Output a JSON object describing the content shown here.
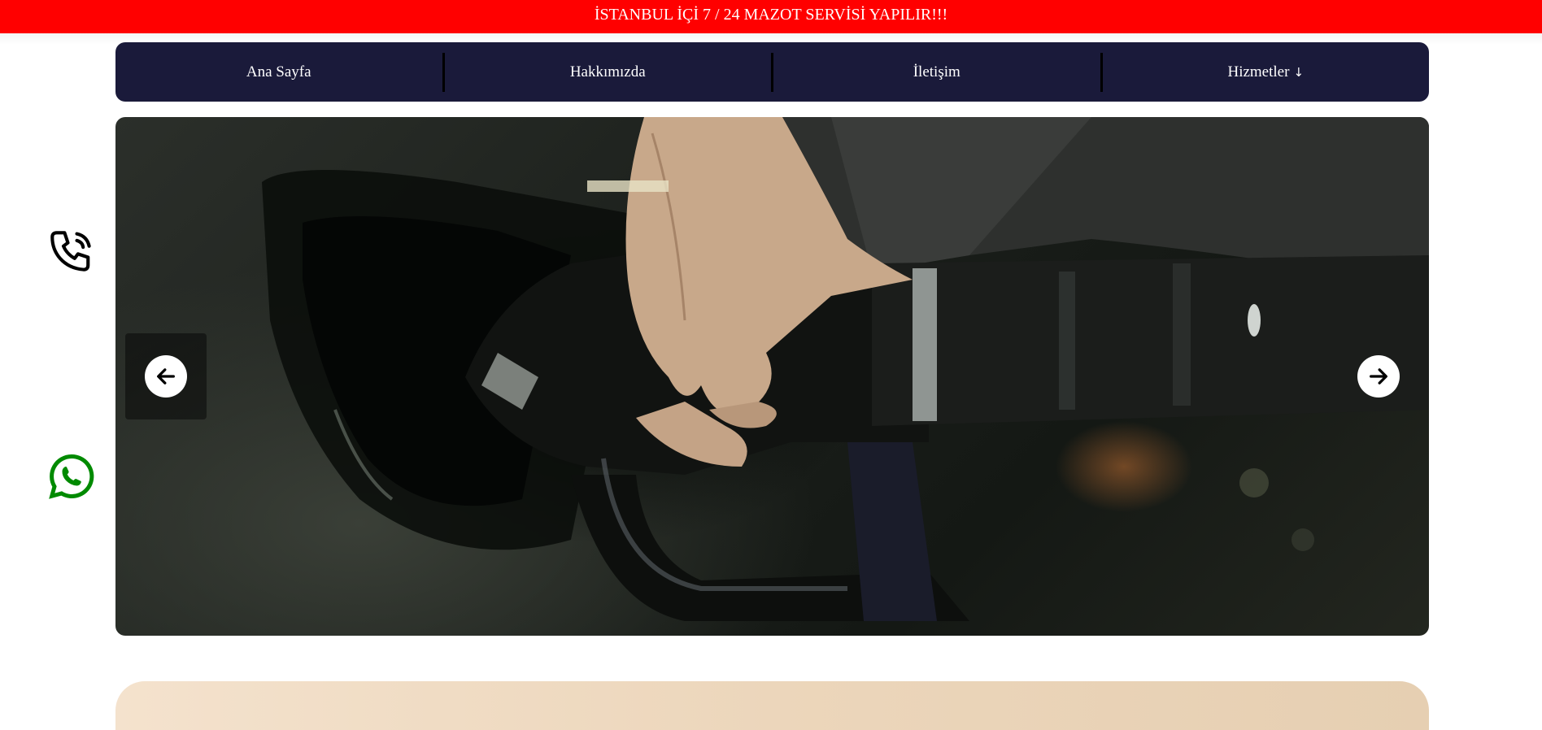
{
  "banner": {
    "text": "İSTANBUL İÇİ 7 / 24 MAZOT SERVİSİ YAPILIR!!!"
  },
  "nav": {
    "items": [
      {
        "label": "Ana Sayfa"
      },
      {
        "label": "Hakkımızda"
      },
      {
        "label": "İletişim"
      },
      {
        "label": "Hizmetler"
      }
    ],
    "dropdown_arrow": "↓"
  },
  "slider": {
    "image": "fuel-nozzle-photo",
    "prev_icon": "arrow-left-icon",
    "next_icon": "arrow-right-icon"
  },
  "floating": {
    "phone_icon": "phone-icon",
    "whatsapp_icon": "whatsapp-icon"
  },
  "colors": {
    "banner_bg": "#ff0000",
    "nav_bg": "#1a1a3a",
    "whatsapp_green": "#008a00"
  }
}
